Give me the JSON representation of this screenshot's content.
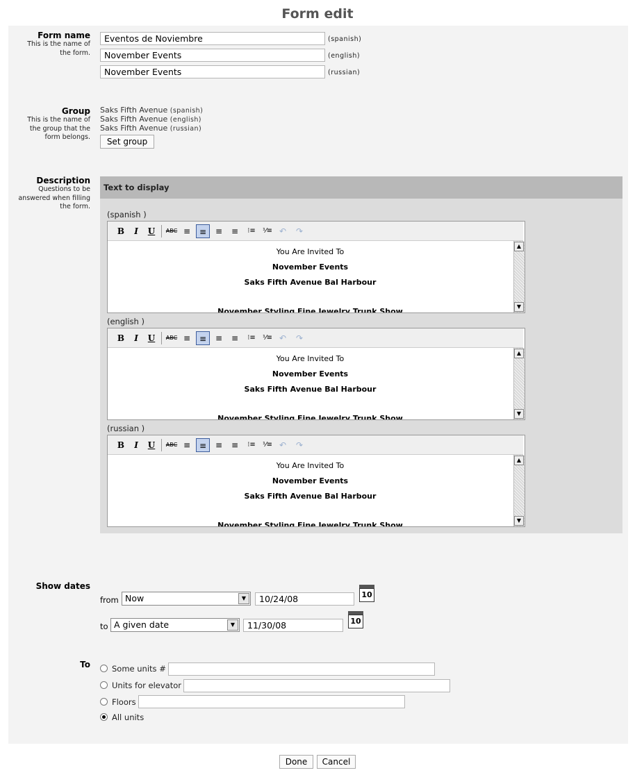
{
  "page": {
    "title": "Form edit"
  },
  "form_name": {
    "label": "Form name",
    "help": [
      "This is the name of",
      "the form."
    ],
    "fields": [
      {
        "value": "Eventos de Noviembre",
        "lang": "(spanish)"
      },
      {
        "value": "November Events",
        "lang": "(english)"
      },
      {
        "value": "November Events",
        "lang": "(russian)"
      }
    ]
  },
  "group": {
    "label": "Group",
    "help": [
      "This is the name of",
      "the group that the",
      "form belongs."
    ],
    "values": [
      {
        "name": "Saks Fifth Avenue",
        "lang": "(spanish)"
      },
      {
        "name": "Saks Fifth Avenue",
        "lang": "(english)"
      },
      {
        "name": "Saks Fifth Avenue",
        "lang": "(russian)"
      }
    ],
    "set_button": "Set group"
  },
  "description": {
    "label": "Description",
    "help": [
      "Questions to be",
      "answered when filling",
      "the form."
    ],
    "box_title": "Text to display",
    "editors": [
      {
        "lang": "(spanish )",
        "lines": [
          "You Are Invited To",
          "November Events",
          "Saks Fifth Avenue Bal Harbour",
          "November Styling Fine Jewelry Trunk Show"
        ]
      },
      {
        "lang": "(english )",
        "lines": [
          "You Are Invited To",
          "November Events",
          "Saks Fifth Avenue Bal Harbour",
          "November Styling Fine Jewelry Trunk Show"
        ]
      },
      {
        "lang": "(russian )",
        "lines": [
          "You Are Invited To",
          "November Events",
          "Saks Fifth Avenue Bal Harbour",
          "November Styling Fine Jewelry Trunk Show"
        ]
      }
    ],
    "toolbar": {
      "bold": "B",
      "italic": "I",
      "underline": "U",
      "strike": "ABC",
      "align_left": "≡",
      "align_center": "≡",
      "align_right": "≡",
      "align_justify": "≡",
      "bullet_list": "⁝≡",
      "number_list": "⅟≡",
      "undo": "↶",
      "redo": "↷"
    }
  },
  "dates": {
    "label": "Show dates",
    "from_label": "from",
    "from_select": "Now",
    "from_date": "10/24/08",
    "to_label": "to",
    "to_select": "A given date",
    "to_date": "11/30/08",
    "calendar_day": "10"
  },
  "to": {
    "label": "To",
    "options": [
      {
        "label": "Some units #",
        "checked": false,
        "value": ""
      },
      {
        "label": "Units for elevator",
        "checked": false,
        "value": ""
      },
      {
        "label": "Floors",
        "checked": false,
        "value": ""
      },
      {
        "label": "All units",
        "checked": true
      }
    ]
  },
  "actions": {
    "done": "Done",
    "cancel": "Cancel"
  }
}
